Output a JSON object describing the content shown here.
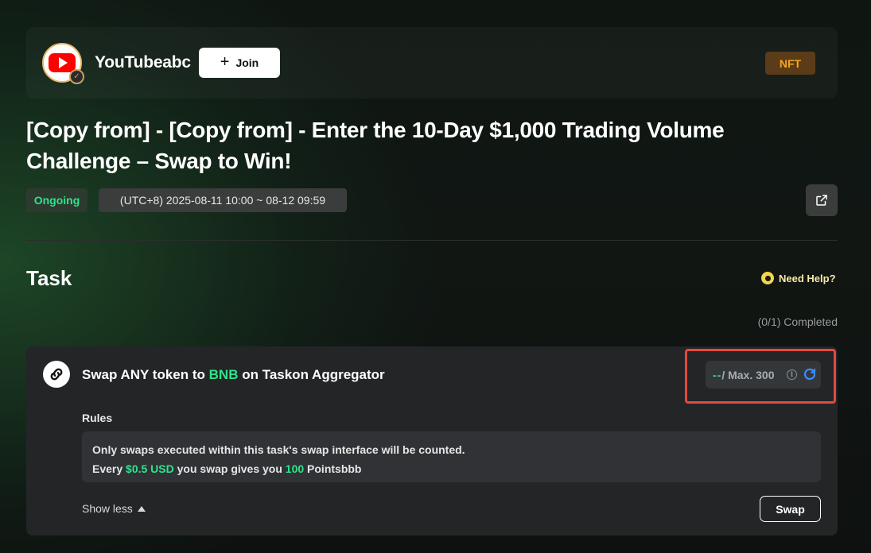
{
  "header": {
    "channel_name": "YouTubeabc",
    "join_label": "Join",
    "tag": "NFT",
    "avatar_icon": "youtube-logo",
    "badge_icon": "verified-badge"
  },
  "campaign": {
    "title": "[Copy from] - [Copy from] - Enter the 10-Day $1,000 Trading Volume Challenge – Swap to Win!",
    "status": "Ongoing",
    "date_range": "(UTC+8) 2025-08-11 10:00 ~ 08-12 09:59"
  },
  "task_section": {
    "title": "Task",
    "help_label": "Need Help?",
    "completed": "(0/1) Completed"
  },
  "task": {
    "title_prefix": "Swap ANY token to ",
    "title_token": "BNB",
    "title_suffix": " on Taskon Aggregator",
    "progress_current": "--",
    "progress_max": "/ Max. 300",
    "rules_label": "Rules",
    "rule_line1": "Only swaps executed within this task's swap interface will be counted.",
    "rule_line2_a": "Every ",
    "rule_line2_amount": "$0.5 USD",
    "rule_line2_b": " you swap gives you ",
    "rule_line2_points": "100",
    "rule_line2_c": " Pointsbbb",
    "show_less_label": "Show less",
    "swap_label": "Swap"
  },
  "colors": {
    "accent_green": "#2ee48a",
    "nft_orange": "#f5a623",
    "highlight_red": "#e5483f"
  }
}
